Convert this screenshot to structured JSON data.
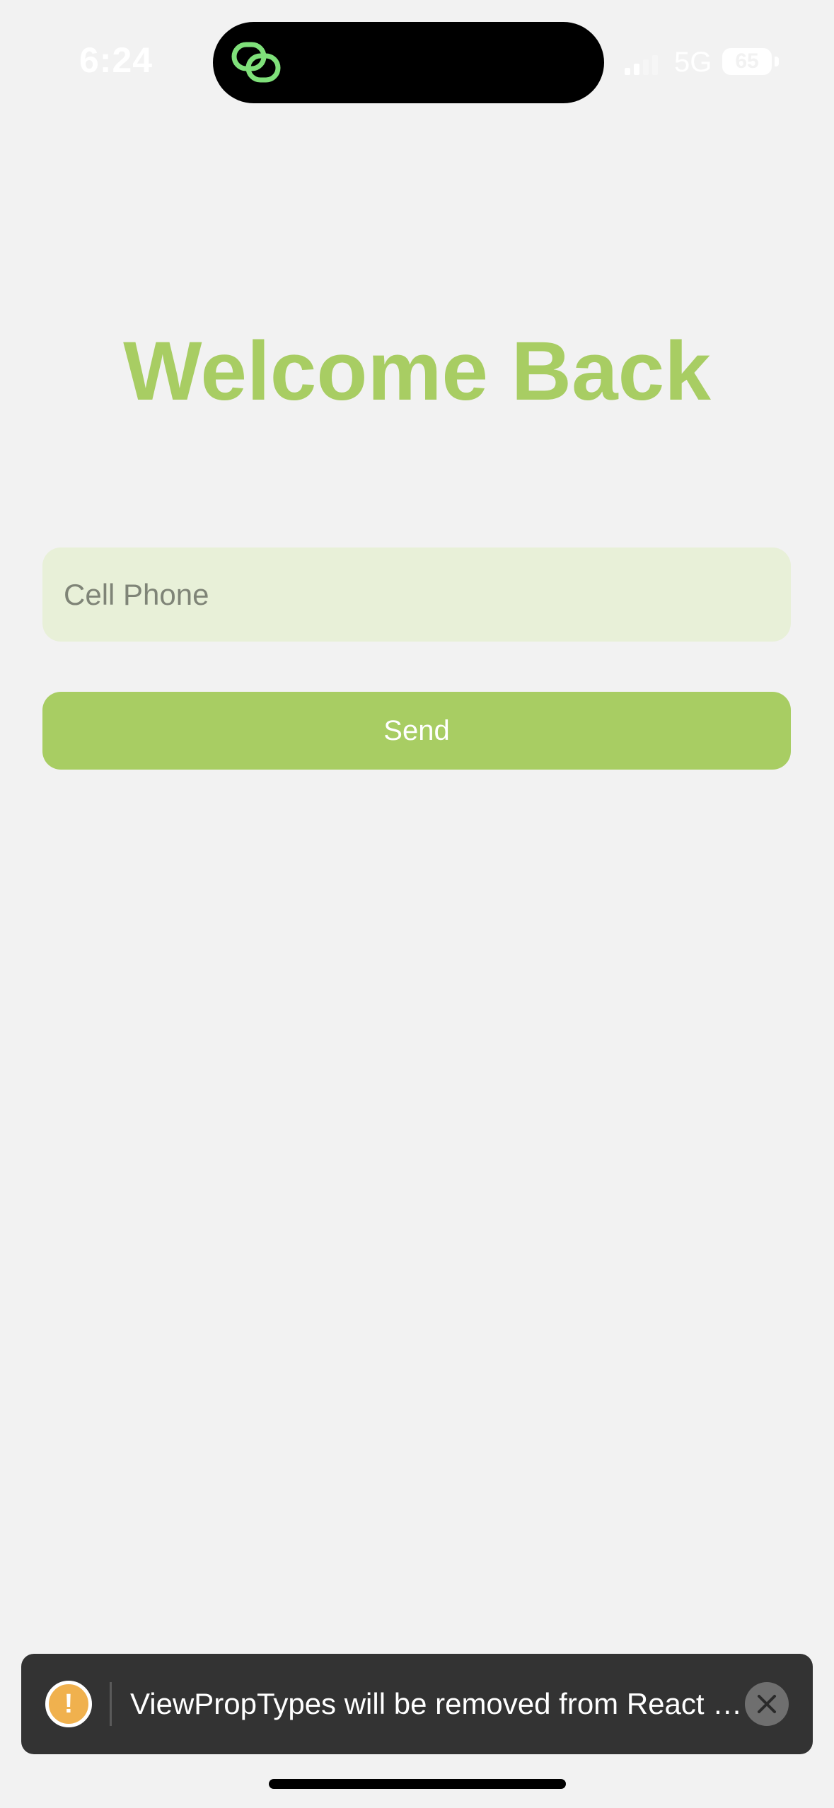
{
  "status_bar": {
    "time": "6:24",
    "network": "5G",
    "battery_percent": "65",
    "island_icon": "linked-rings-icon",
    "signal_icon": "cellular-signal-icon"
  },
  "screen": {
    "title": "Welcome Back",
    "phone_field": {
      "placeholder": "Cell Phone",
      "value": ""
    },
    "send_label": "Send"
  },
  "toast": {
    "icon": "warning-icon",
    "message": "ViewPropTypes will be removed from React Native, along with all other PropTypes. We recommend that you migrate away from PropTypes and switch to a type system like TypeScript.",
    "close_icon": "close-icon"
  },
  "colors": {
    "accent": "#a8cd63",
    "input_background": "#e8f0d8",
    "page_background": "#f2f2f2",
    "toast_background": "#333333",
    "warning": "#f0b14e"
  }
}
